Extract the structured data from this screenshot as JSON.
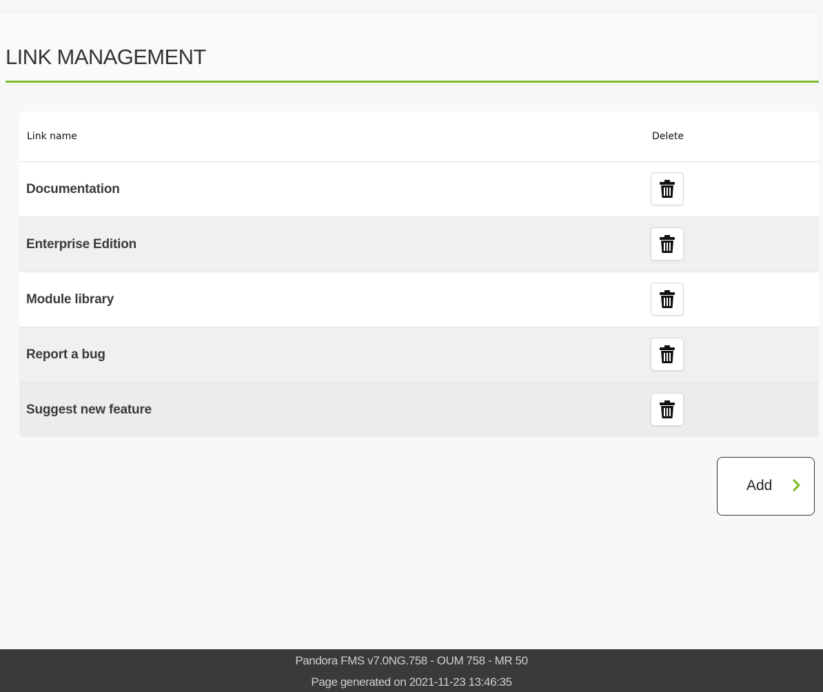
{
  "page": {
    "title": "LINK MANAGEMENT"
  },
  "table": {
    "headers": {
      "name": "Link name",
      "delete": "Delete"
    },
    "rows": [
      {
        "name": "Documentation"
      },
      {
        "name": "Enterprise Edition"
      },
      {
        "name": "Module library"
      },
      {
        "name": "Report a bug"
      },
      {
        "name": "Suggest new feature"
      }
    ],
    "delete_icon": "trash-icon"
  },
  "actions": {
    "add_label": "Add",
    "add_icon": "chevron-right-icon"
  },
  "footer": {
    "version": "Pandora FMS v7.0NG.758 - OUM 758 - MR 50",
    "generated": "Page generated on 2021-11-23 13:46:35"
  },
  "colors": {
    "accent": "#82b92e",
    "footer_bg": "#3a3a3a",
    "row_alt": "#f0f0f0"
  }
}
